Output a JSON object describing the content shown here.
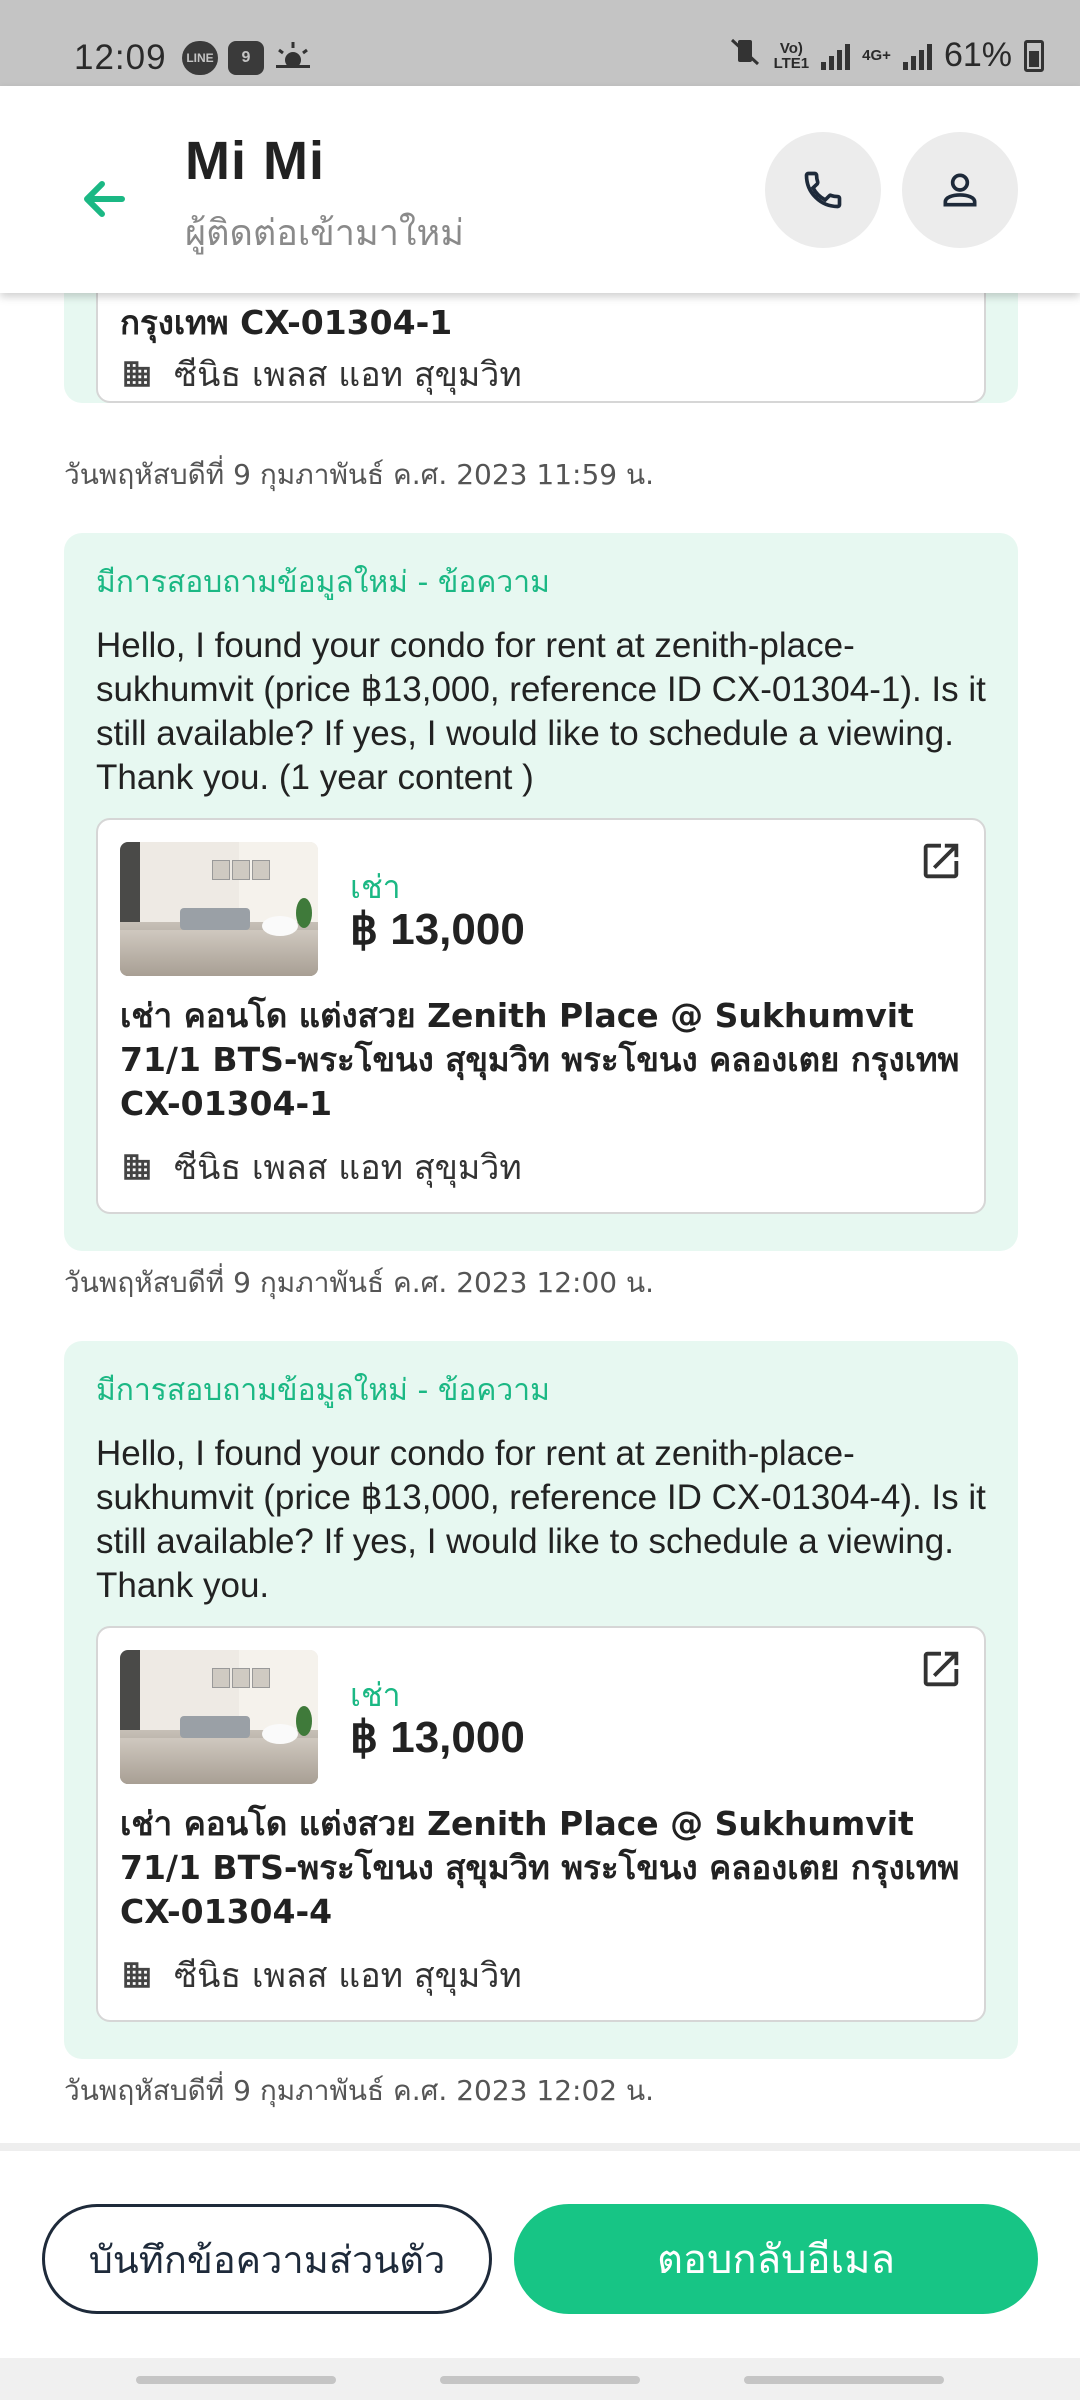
{
  "status_bar": {
    "time": "12:09",
    "left_icons": [
      "line-icon",
      "calendar-icon",
      "weather-icon"
    ],
    "calendar_day": "9",
    "line_label": "LINE",
    "network_top": "Vo)",
    "network_bottom": "LTE1",
    "network_type": "4G+",
    "battery": "61%"
  },
  "header": {
    "name": "Mi Mi",
    "subtitle": "ผู้ติดต่อเข้ามาใหม่",
    "accent": "#1bb884"
  },
  "messages": [
    {
      "partial": true,
      "card": {
        "title_tail": "กรุงเทพ CX-01304-1",
        "building": "ซีนิธ เพลส แอท สุขุมวิท"
      },
      "timestamp": "วันพฤหัสบดีที่ 9 กุมภาพันธ์ ค.ศ. 2023 11:59 น."
    },
    {
      "title": "มีการสอบถามข้อมูลใหม่ - ข้อความ",
      "body": "Hello, I found your condo for rent at zenith-place-sukhumvit (price ฿13,000, reference ID CX-01304-1). Is it still available? If yes, I would like to schedule a viewing. Thank you. (1 year content )",
      "card": {
        "rent_label": "เช่า",
        "price": "฿ 13,000",
        "title": "เช่า คอนโด แต่งสวย Zenith Place @ Sukhumvit 71/1 BTS-พระโขนง สุขุมวิท พระโขนง คลองเตย กรุงเทพ CX-01304-1",
        "building": "ซีนิธ เพลส แอท สุขุมวิท"
      },
      "timestamp": "วันพฤหัสบดีที่ 9 กุมภาพันธ์ ค.ศ. 2023 12:00 น."
    },
    {
      "title": "มีการสอบถามข้อมูลใหม่ - ข้อความ",
      "body": "Hello, I found your condo for rent at zenith-place-sukhumvit (price ฿13,000, reference ID CX-01304-4). Is it still available? If yes, I would like to schedule a viewing. Thank you.",
      "card": {
        "rent_label": "เช่า",
        "price": "฿ 13,000",
        "title": "เช่า คอนโด แต่งสวย Zenith Place @ Sukhumvit 71/1 BTS-พระโขนง สุขุมวิท พระโขนง คลองเตย กรุงเทพ CX-01304-4",
        "building": "ซีนิธ เพลส แอท สุขุมวิท"
      },
      "timestamp": "วันพฤหัสบดีที่ 9 กุมภาพันธ์ ค.ศ. 2023 12:02 น."
    }
  ],
  "actions": {
    "private_note": "บันทึกข้อความส่วนตัว",
    "reply_email": "ตอบกลับอีเมล",
    "primary_color": "#17c585"
  },
  "icons": {
    "back": "arrow-left-icon",
    "call": "phone-icon",
    "profile": "person-icon",
    "open": "open-external-icon",
    "building": "building-icon"
  }
}
